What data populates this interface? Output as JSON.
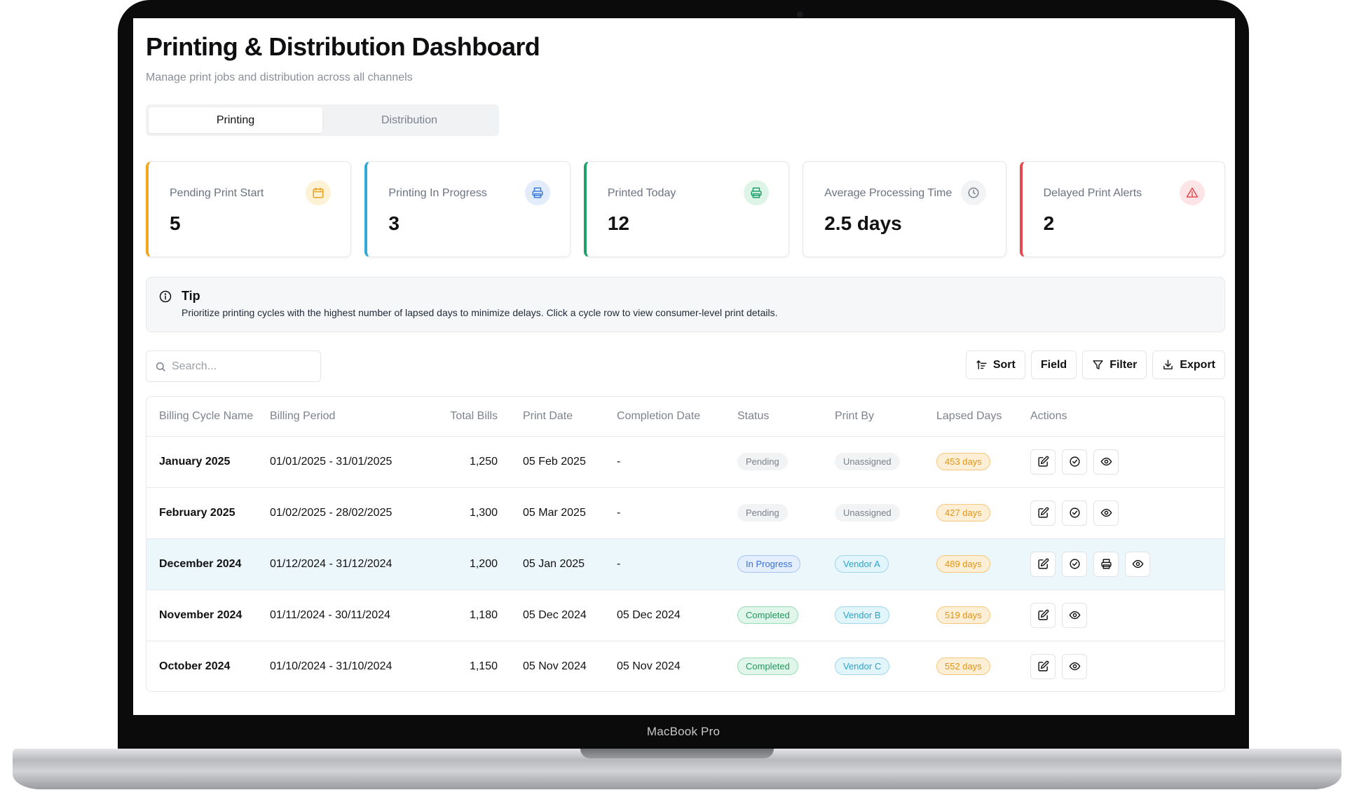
{
  "device": {
    "label": "MacBook Pro"
  },
  "header": {
    "title": "Printing & Distribution Dashboard",
    "subtitle": "Manage print jobs and distribution across all channels"
  },
  "tabs": [
    {
      "label": "Printing",
      "active": true
    },
    {
      "label": "Distribution",
      "active": false
    }
  ],
  "kpis": [
    {
      "label": "Pending Print Start",
      "value": "5",
      "icon": "calendar-icon",
      "accent": "#f2a81d",
      "icon_bg": "#fdf2d6"
    },
    {
      "label": "Printing In Progress",
      "value": "3",
      "icon": "printer-icon",
      "accent": "#33a9d6",
      "icon_bg": "#e2ecfb"
    },
    {
      "label": "Printed Today",
      "value": "12",
      "icon": "printer-icon",
      "accent": "#1ea26a",
      "icon_bg": "#ddf4e7"
    },
    {
      "label": "Average Processing Time",
      "value": "2.5 days",
      "icon": "clock-icon",
      "accent": null,
      "icon_bg": "#f2f3f5"
    },
    {
      "label": "Delayed Print Alerts",
      "value": "2",
      "icon": "alert-triangle-icon",
      "accent": "#e5484d",
      "icon_bg": "#fde4e6"
    }
  ],
  "tip": {
    "title": "Tip",
    "text": "Prioritize printing cycles with the highest number of lapsed days to minimize delays. Click a cycle row to view consumer-level print details."
  },
  "search": {
    "placeholder": "Search...",
    "value": ""
  },
  "toolbar": {
    "sort_label": "Sort",
    "field_label": "Field",
    "filter_label": "Filter",
    "export_label": "Export"
  },
  "table": {
    "columns": [
      "Billing Cycle Name",
      "Billing Period",
      "Total Bills",
      "Print Date",
      "Completion Date",
      "Status",
      "Print By",
      "Lapsed Days",
      "Actions"
    ],
    "rows": [
      {
        "name": "January 2025",
        "period": "01/01/2025 - 31/01/2025",
        "bills": "1,250",
        "print_date": "05 Feb 2025",
        "completion": "-",
        "status": "Pending",
        "status_kind": "pending",
        "print_by": "Unassigned",
        "print_by_kind": "unassigned",
        "lapsed": "453 days",
        "highlight": false,
        "actions": [
          "edit-icon",
          "check-circle-icon",
          "eye-icon"
        ]
      },
      {
        "name": "February 2025",
        "period": "01/02/2025 - 28/02/2025",
        "bills": "1,300",
        "print_date": "05 Mar 2025",
        "completion": "-",
        "status": "Pending",
        "status_kind": "pending",
        "print_by": "Unassigned",
        "print_by_kind": "unassigned",
        "lapsed": "427 days",
        "highlight": false,
        "actions": [
          "edit-icon",
          "check-circle-icon",
          "eye-icon"
        ]
      },
      {
        "name": "December 2024",
        "period": "01/12/2024 - 31/12/2024",
        "bills": "1,200",
        "print_date": "05 Jan 2025",
        "completion": "-",
        "status": "In Progress",
        "status_kind": "progress",
        "print_by": "Vendor A",
        "print_by_kind": "vendor",
        "lapsed": "489 days",
        "highlight": true,
        "actions": [
          "edit-icon",
          "check-circle-icon",
          "printer-icon",
          "eye-icon"
        ]
      },
      {
        "name": "November 2024",
        "period": "01/11/2024 - 30/11/2024",
        "bills": "1,180",
        "print_date": "05 Dec 2024",
        "completion": "05 Dec 2024",
        "status": "Completed",
        "status_kind": "completed",
        "print_by": "Vendor B",
        "print_by_kind": "vendor",
        "lapsed": "519 days",
        "highlight": false,
        "actions": [
          "edit-icon",
          "eye-icon"
        ]
      },
      {
        "name": "October 2024",
        "period": "01/10/2024 - 31/10/2024",
        "bills": "1,150",
        "print_date": "05 Nov 2024",
        "completion": "05 Nov 2024",
        "status": "Completed",
        "status_kind": "completed",
        "print_by": "Vendor C",
        "print_by_kind": "vendor",
        "lapsed": "552 days",
        "highlight": false,
        "actions": [
          "edit-icon",
          "eye-icon"
        ]
      }
    ]
  }
}
